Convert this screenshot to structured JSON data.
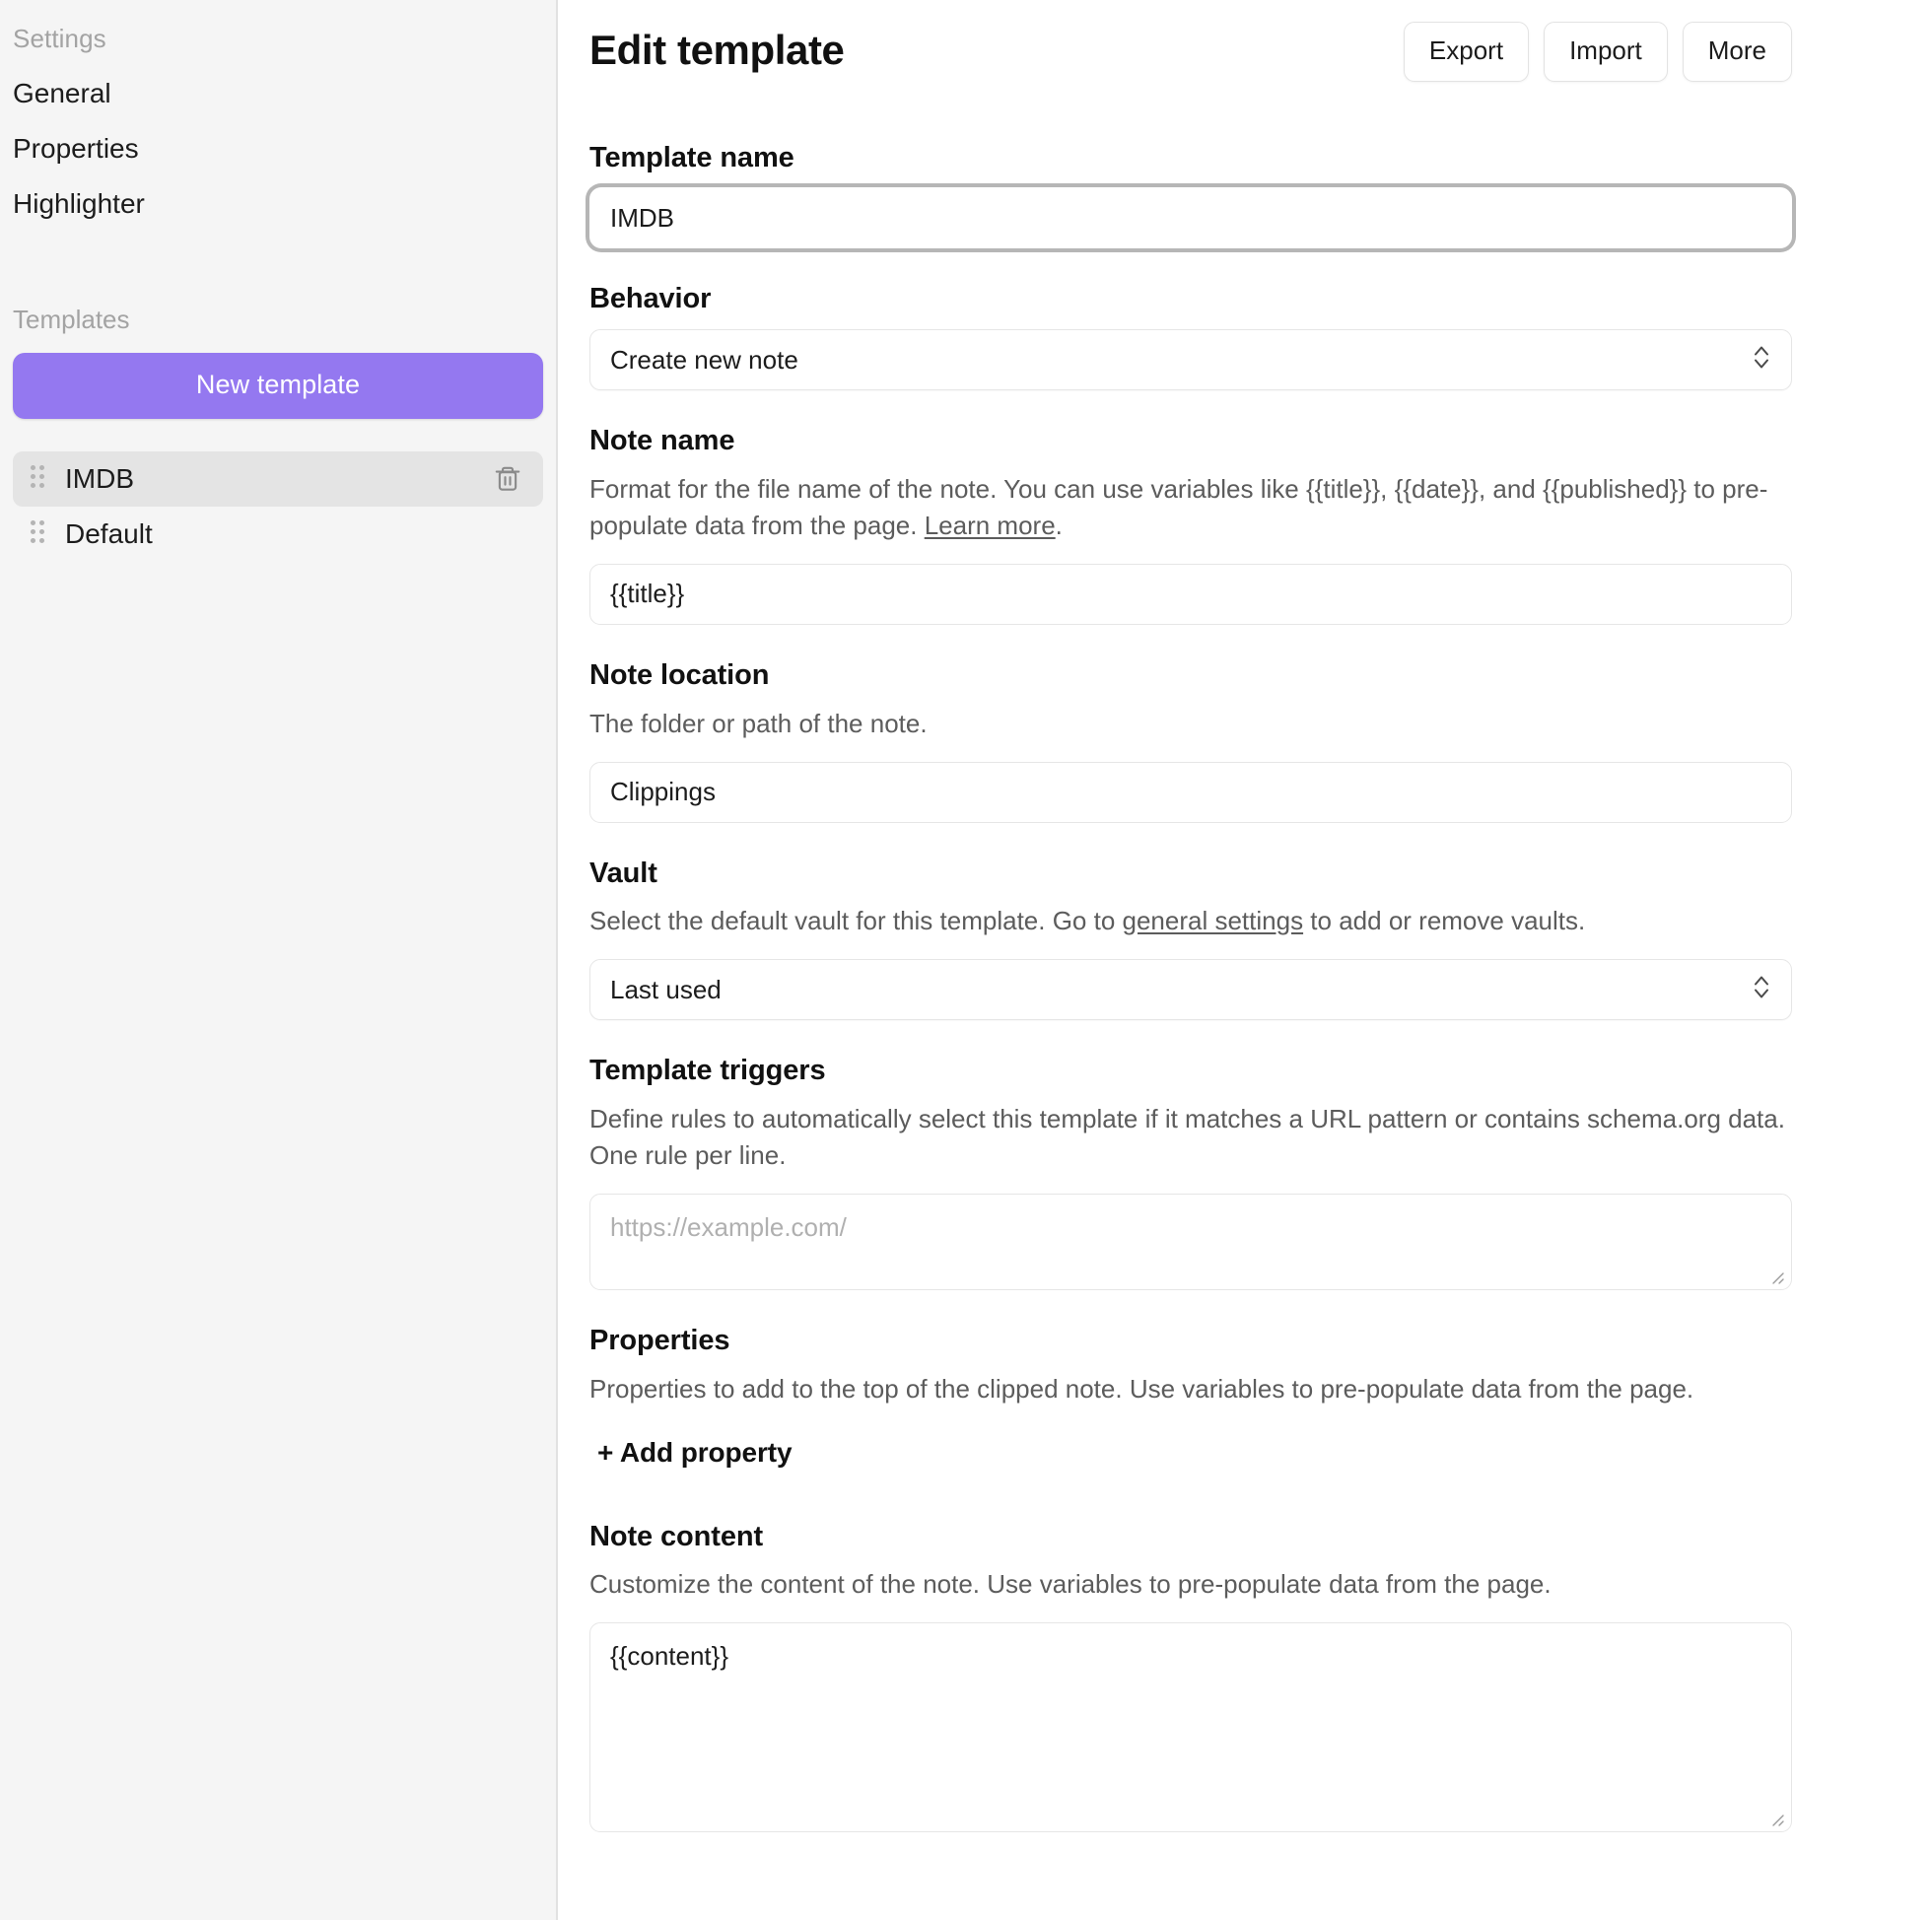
{
  "sidebar": {
    "settings_heading": "Settings",
    "nav_items": [
      {
        "label": "General"
      },
      {
        "label": "Properties"
      },
      {
        "label": "Highlighter"
      }
    ],
    "templates_heading": "Templates",
    "new_template_label": "New template",
    "templates": [
      {
        "label": "IMDB",
        "active": true,
        "deletable": true
      },
      {
        "label": "Default",
        "active": false,
        "deletable": false
      }
    ]
  },
  "header": {
    "title": "Edit template",
    "export_label": "Export",
    "import_label": "Import",
    "more_label": "More"
  },
  "form": {
    "template_name": {
      "label": "Template name",
      "value": "IMDB",
      "placeholder": ""
    },
    "behavior": {
      "label": "Behavior",
      "value": "Create new note"
    },
    "note_name": {
      "label": "Note name",
      "desc_before_link": "Format for the file name of the note. You can use variables like {{title}}, {{date}}, and {{published}} to pre-populate data from the page. ",
      "link_text": "Learn more",
      "desc_after_link": ".",
      "value": "{{title}}",
      "placeholder": ""
    },
    "note_location": {
      "label": "Note location",
      "desc": "The folder or path of the note.",
      "value": "Clippings",
      "placeholder": ""
    },
    "vault": {
      "label": "Vault",
      "desc_before_link": "Select the default vault for this template. Go to ",
      "link_text": "general settings",
      "desc_after_link": " to add or remove vaults.",
      "value": "Last used"
    },
    "template_triggers": {
      "label": "Template triggers",
      "desc": "Define rules to automatically select this template if it matches a URL pattern or contains schema.org data. One rule per line.",
      "value": "",
      "placeholder": "https://example.com/"
    },
    "properties": {
      "label": "Properties",
      "desc": "Properties to add to the top of the clipped note. Use variables to pre-populate data from the page.",
      "add_label": "+ Add property"
    },
    "note_content": {
      "label": "Note content",
      "desc": "Customize the content of the note. Use variables to pre-populate data from the page.",
      "value": "{{content}}",
      "placeholder": ""
    }
  },
  "colors": {
    "accent_purple": "#9478F0",
    "sidebar_bg": "#F5F5F5",
    "active_row": "#E4E4E4",
    "text_primary": "#1C1C1C",
    "text_muted": "#A3A3A3",
    "desc_text": "#5C5C5C",
    "border": "#E6E6E6"
  },
  "icons": {
    "drag_handle": "drag-handle-icon",
    "trash": "trash-icon",
    "chevron_updown": "chevron-up-down-icon",
    "resize_grip": "resize-grip-icon"
  }
}
